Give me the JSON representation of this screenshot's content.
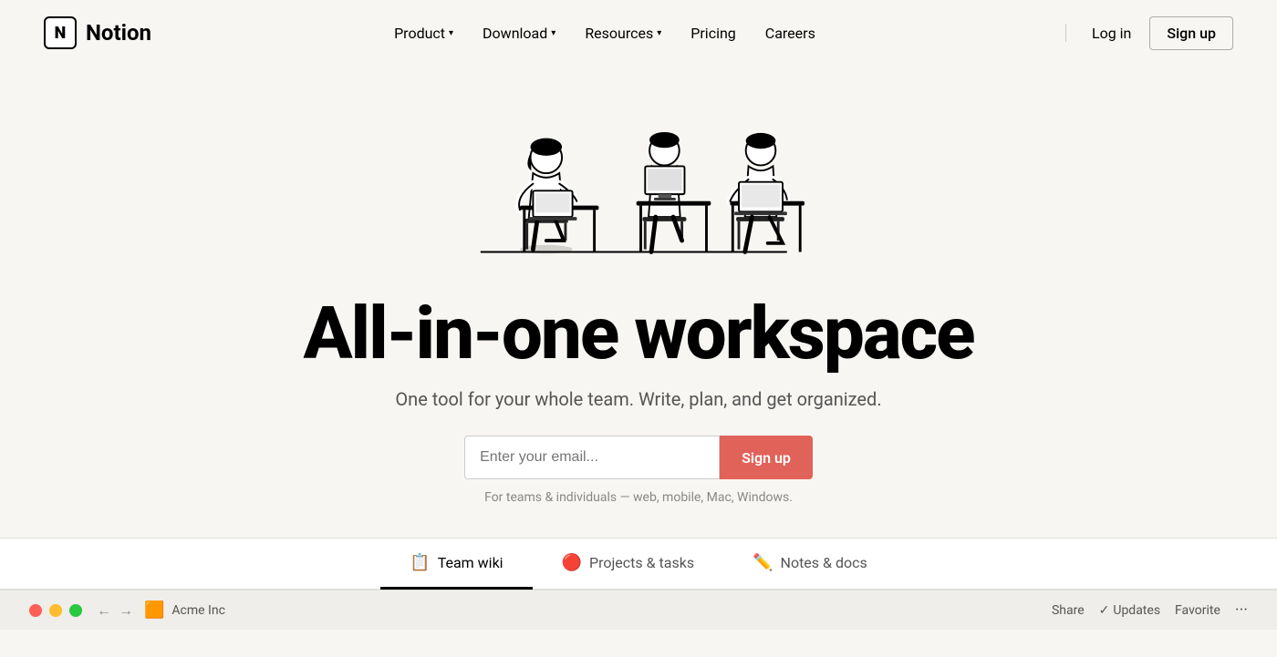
{
  "nav": {
    "logo_text": "Notion",
    "logo_icon": "N",
    "items": [
      {
        "label": "Product",
        "has_dropdown": true
      },
      {
        "label": "Download",
        "has_dropdown": true
      },
      {
        "label": "Resources",
        "has_dropdown": true
      },
      {
        "label": "Pricing",
        "has_dropdown": false
      },
      {
        "label": "Careers",
        "has_dropdown": false
      }
    ],
    "login_label": "Log in",
    "signup_label": "Sign up"
  },
  "hero": {
    "title": "All-in-one workspace",
    "subtitle": "One tool for your whole team. Write, plan, and get organized.",
    "email_placeholder": "Enter your email...",
    "cta_button": "Sign up",
    "note": "For teams & individuals — web, mobile, Mac, Windows."
  },
  "tabs": [
    {
      "emoji": "📋",
      "label": "Team wiki",
      "active": true
    },
    {
      "emoji": "🔴",
      "label": "Projects & tasks",
      "active": false
    },
    {
      "emoji": "✏️",
      "label": "Notes & docs",
      "active": false
    }
  ],
  "bottom_bar": {
    "breadcrumb": "Acme Inc",
    "share_label": "Share",
    "updates_label": "Updates",
    "favorite_label": "Favorite"
  },
  "colors": {
    "signup_button": "#e16259",
    "active_tab_border": "#000000",
    "background": "#f7f6f3"
  }
}
